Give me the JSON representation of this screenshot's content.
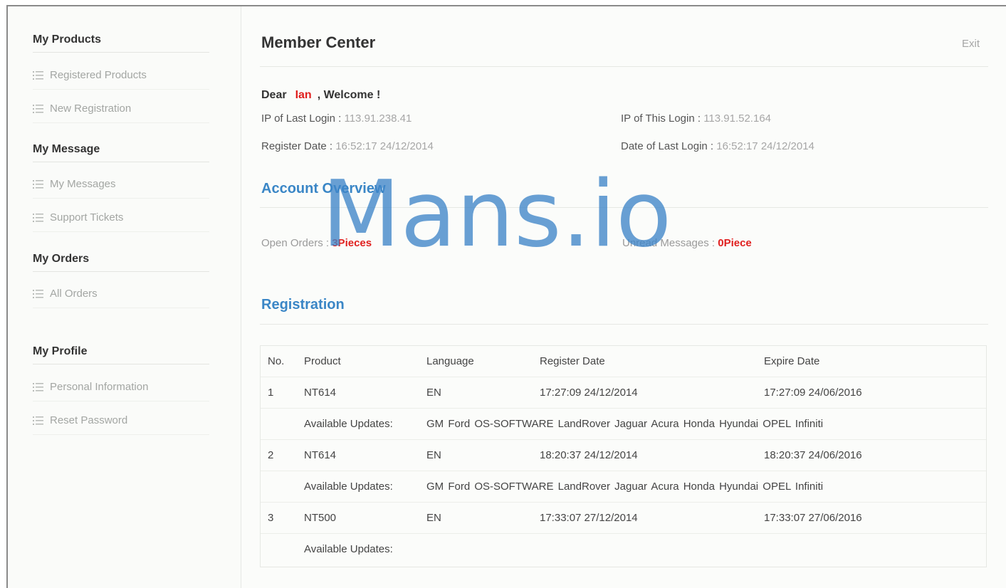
{
  "sidebar": {
    "groups": [
      {
        "title": "My Products",
        "items": [
          "Registered Products",
          "New Registration"
        ]
      },
      {
        "title": "My Message",
        "items": [
          "My Messages",
          "Support Tickets"
        ]
      },
      {
        "title": "My Orders",
        "items": [
          "All Orders"
        ]
      },
      {
        "title": "My Profile",
        "items": [
          "Personal Information",
          "Reset Password"
        ]
      }
    ],
    "item_icon": "list-icon"
  },
  "header": {
    "title": "Member Center",
    "exit_label": "Exit"
  },
  "welcome": {
    "prefix": "Dear",
    "name": "Ian",
    "suffix": ", Welcome !"
  },
  "login_info": {
    "last_ip_label": "IP of Last Login : ",
    "last_ip": "113.91.238.41",
    "this_ip_label": "IP of This Login : ",
    "this_ip": "113.91.52.164",
    "register_date_label": "Register Date  : ",
    "register_date": "16:52:17 24/12/2014",
    "last_login_date_label": "Date of Last Login : ",
    "last_login_date": "16:52:17 24/12/2014"
  },
  "account_overview": {
    "title": "Account Overview",
    "open_orders_label": "Open Orders : ",
    "open_orders_value": "3Pieces",
    "unread_label": "Unread Messages : ",
    "unread_value": "0Piece"
  },
  "registration": {
    "title": "Registration",
    "columns": [
      "No.",
      "Product",
      "Language",
      "Register Date",
      "Expire Date"
    ],
    "updates_label": "Available Updates:",
    "rows": [
      {
        "no": "1",
        "product": "NT614",
        "language": "EN",
        "register_date": "17:27:09 24/12/2014",
        "expire_date": "17:27:09 24/06/2016",
        "updates": "GM Ford OS-SOFTWARE LandRover Jaguar Acura Honda Hyundai OPEL Infiniti"
      },
      {
        "no": "2",
        "product": "NT614",
        "language": "EN",
        "register_date": "18:20:37 24/12/2014",
        "expire_date": "18:20:37 24/06/2016",
        "updates": "GM Ford OS-SOFTWARE LandRover Jaguar Acura Honda Hyundai OPEL Infiniti"
      },
      {
        "no": "3",
        "product": "NT500",
        "language": "EN",
        "register_date": "17:33:07 27/12/2014",
        "expire_date": "17:33:07 27/06/2016",
        "updates": ""
      }
    ]
  },
  "watermark": "Mans.io",
  "colors": {
    "accent": "#3a86c6",
    "highlight": "#e0201f",
    "muted": "#a6a6a6"
  }
}
